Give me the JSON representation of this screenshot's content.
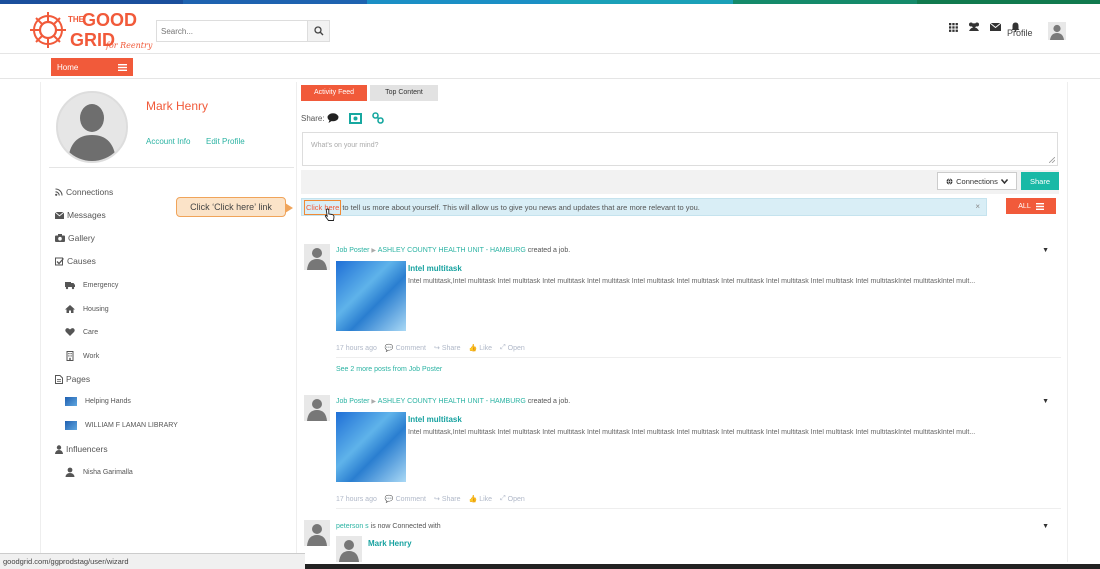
{
  "stripe_colors": [
    "#1a4f9c",
    "#1e63b0",
    "#1b8fc5",
    "#1aa0b8",
    "#158a6a",
    "#117a4e"
  ],
  "header": {
    "logo_line1": "THE",
    "logo_line2": "GOOD",
    "logo_line3": "GRID",
    "logo_tag": "for Reentry",
    "search_placeholder": "Search...",
    "profile_label": "Profile"
  },
  "nav": {
    "home_label": "Home"
  },
  "profile": {
    "name": "Mark Henry",
    "account_info": "Account Info",
    "edit_profile": "Edit Profile"
  },
  "sidebar": {
    "connections": "Connections",
    "messages": "Messages",
    "gallery": "Gallery",
    "causes": "Causes",
    "causes_items": [
      "Emergency",
      "Housing",
      "Care",
      "Work"
    ],
    "pages": "Pages",
    "pages_items": [
      "Helping Hands",
      "WILLIAM F LAMAN LIBRARY"
    ],
    "influencers": "Influencers",
    "influencers_items": [
      "Nisha Garimalla"
    ]
  },
  "feed": {
    "tab_activity": "Activity Feed",
    "tab_top": "Top Content",
    "share_label": "Share:",
    "textbox_placeholder": "What's on your mind?",
    "connections_btn": "Connections",
    "share_btn": "Share",
    "info_link": "Click here",
    "info_text": " to tell us more about yourself. This will allow us to give you news and updates that are more relevant to you.",
    "info_close": "×",
    "all_btn": "ALL",
    "callout": "Click ‘Click here’ link",
    "posts": [
      {
        "author": "Job Poster",
        "target": "ASHLEY COUNTY HEALTH UNIT - HAMBURG",
        "action": "created a job.",
        "title": "Intel multitask",
        "body": "Intel multitask,Intel multitask Intel multitask Intel multitask Intel multitask Intel multitask Intel multitask Intel multitask Intel multitask Intel multitask  Intel multitaskIntel multitaskIntel mult...",
        "time": "17 hours ago",
        "comment": "Comment",
        "share": "Share",
        "like": "Like",
        "open": "Open",
        "see_more": "See 2 more posts from Job Poster"
      },
      {
        "author": "Job Poster",
        "target": "ASHLEY COUNTY HEALTH UNIT - HAMBURG",
        "action": "created a job.",
        "title": "Intel multitask",
        "body": "Intel multitask,Intel multitask Intel multitask Intel multitask Intel multitask Intel multitask Intel multitask Intel multitask Intel multitask Intel multitask  Intel multitaskIntel multitaskIntel mult...",
        "time": "17 hours ago",
        "comment": "Comment",
        "share": "Share",
        "like": "Like",
        "open": "Open"
      }
    ],
    "connection_post": {
      "author": "peterson s",
      "action": "is now Connected with",
      "connected_name": "Mark Henry"
    }
  },
  "statusbar_url": "goodgrid.com/ggprodstag/user/wizard"
}
